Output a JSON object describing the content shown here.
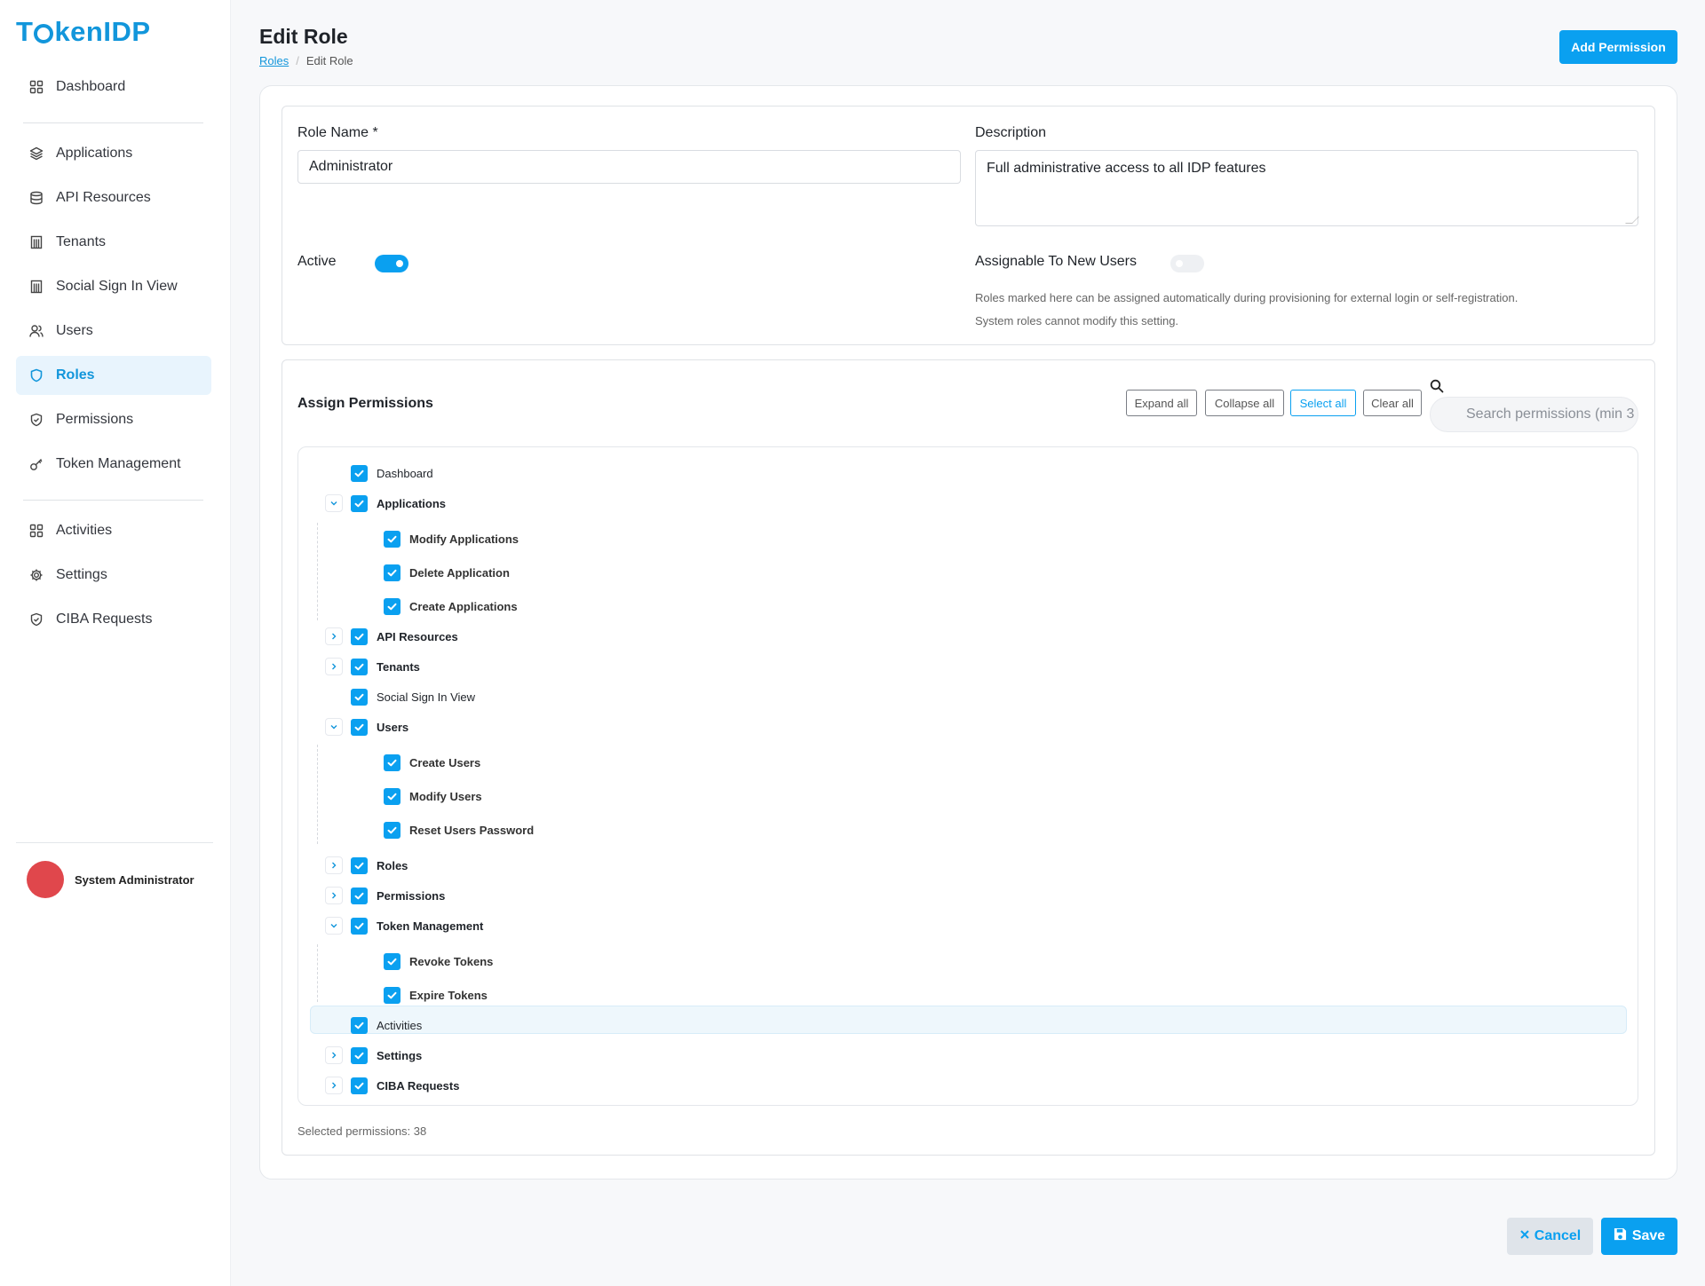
{
  "brand": {
    "logo_text_a": "T",
    "logo_text_b": "kenIDP",
    "color": "#1296db"
  },
  "sidebar": {
    "items": [
      {
        "label": "Dashboard",
        "icon": "grid-icon"
      },
      {
        "label": "Applications",
        "icon": "layers-icon"
      },
      {
        "label": "API Resources",
        "icon": "database-icon"
      },
      {
        "label": "Tenants",
        "icon": "building-icon"
      },
      {
        "label": "Social Sign In View",
        "icon": "building-icon"
      },
      {
        "label": "Users",
        "icon": "users-icon"
      },
      {
        "label": "Roles",
        "icon": "shield-icon",
        "active": true
      },
      {
        "label": "Permissions",
        "icon": "shield-check-icon"
      },
      {
        "label": "Token Management",
        "icon": "key-icon"
      },
      {
        "label": "Activities",
        "icon": "grid-icon"
      },
      {
        "label": "Settings",
        "icon": "gear-icon"
      },
      {
        "label": "CIBA Requests",
        "icon": "shield-check-icon"
      }
    ],
    "user": {
      "name": "System Administrator",
      "avatar_color": "#e0474c"
    }
  },
  "header": {
    "title": "Edit Role",
    "breadcrumb": {
      "parent": "Roles",
      "sep": "/",
      "current": "Edit Role"
    },
    "add_permission_label": "Add Permission"
  },
  "form": {
    "role_name_label": "Role Name *",
    "role_name_value": "Administrator",
    "description_label": "Description",
    "description_value": "Full administrative access to all IDP features",
    "active_label": "Active",
    "active_on": true,
    "assignable_label": "Assignable To New Users",
    "assignable_on": false,
    "hint_line1": "Roles marked here can be assigned automatically during provisioning for external login or self-registration.",
    "hint_line2": "System roles cannot modify this setting."
  },
  "permissions": {
    "title": "Assign Permissions",
    "expand_all": "Expand all",
    "collapse_all": "Collapse all",
    "select_all": "Select all",
    "clear_all": "Clear all",
    "search_placeholder": "Search permissions (min 3",
    "tree": [
      {
        "label": "Dashboard",
        "level": 0,
        "expander": "none",
        "checked": true
      },
      {
        "label": "Applications",
        "level": 0,
        "expander": "expanded",
        "checked": true
      },
      {
        "label": "Modify Applications",
        "level": 1,
        "checked": true
      },
      {
        "label": "Delete Application",
        "level": 1,
        "checked": true
      },
      {
        "label": "Create Applications",
        "level": 1,
        "checked": true
      },
      {
        "label": "API Resources",
        "level": 0,
        "expander": "collapsed",
        "checked": true
      },
      {
        "label": "Tenants",
        "level": 0,
        "expander": "collapsed",
        "checked": true
      },
      {
        "label": "Social Sign In View",
        "level": 0,
        "expander": "none",
        "checked": true
      },
      {
        "label": "Users",
        "level": 0,
        "expander": "expanded",
        "checked": true
      },
      {
        "label": "Create Users",
        "level": 1,
        "checked": true
      },
      {
        "label": "Modify Users",
        "level": 1,
        "checked": true
      },
      {
        "label": "Reset Users Password",
        "level": 1,
        "checked": true
      },
      {
        "label": "Roles",
        "level": 0,
        "expander": "collapsed",
        "checked": true
      },
      {
        "label": "Permissions",
        "level": 0,
        "expander": "collapsed",
        "checked": true
      },
      {
        "label": "Token Management",
        "level": 0,
        "expander": "expanded",
        "checked": true
      },
      {
        "label": "Revoke Tokens",
        "level": 1,
        "checked": true
      },
      {
        "label": "Expire Tokens",
        "level": 1,
        "checked": true
      },
      {
        "label": "Activities",
        "level": 0,
        "expander": "none",
        "checked": true,
        "highlighted": true
      },
      {
        "label": "Settings",
        "level": 0,
        "expander": "collapsed",
        "checked": true
      },
      {
        "label": "CIBA Requests",
        "level": 0,
        "expander": "collapsed",
        "checked": true
      }
    ],
    "selected_count_text": "Selected permissions: 38"
  },
  "footer": {
    "cancel_label": "Cancel",
    "save_label": "Save"
  },
  "colors": {
    "accent": "#0aa0f0",
    "active_nav_bg": "#e8f4fd"
  }
}
